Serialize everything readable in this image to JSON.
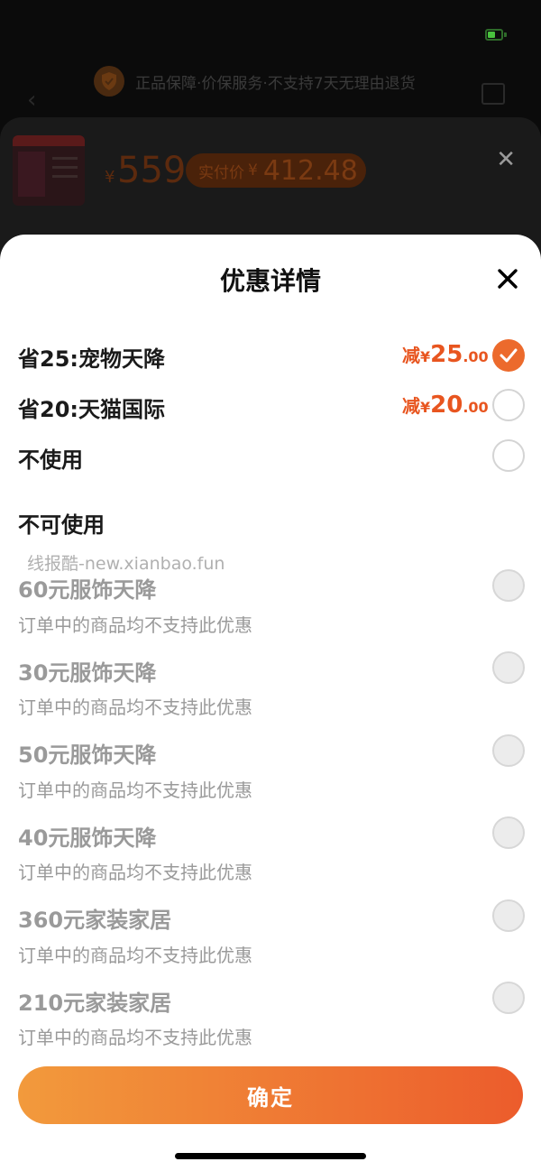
{
  "background": {
    "guarantee_text": "正品保障·价保服务·不支持7天无理由退货",
    "price_currency": "¥",
    "price": "559",
    "paid_label": "实付价",
    "paid_currency": "¥",
    "paid_amount": "412.48"
  },
  "panel": {
    "title": "优惠详情",
    "options": [
      {
        "label": "省25:宠物天降",
        "prefix": "减",
        "currency": "¥",
        "int": "25",
        "dec": ".00",
        "selected": true
      },
      {
        "label": "省20:天猫国际",
        "prefix": "减",
        "currency": "¥",
        "int": "20",
        "dec": ".00",
        "selected": false
      },
      {
        "label": "不使用",
        "selected": false
      }
    ],
    "unavailable_header": "不可使用",
    "watermark": "线报酷-new.xianbao.fun",
    "unavailable": [
      {
        "name": "60元服饰天降",
        "desc": "订单中的商品均不支持此优惠"
      },
      {
        "name": "30元服饰天降",
        "desc": "订单中的商品均不支持此优惠"
      },
      {
        "name": "50元服饰天降",
        "desc": "订单中的商品均不支持此优惠"
      },
      {
        "name": "40元服饰天降",
        "desc": "订单中的商品均不支持此优惠"
      },
      {
        "name": "360元家装家居",
        "desc": "订单中的商品均不支持此优惠"
      },
      {
        "name": "210元家装家居",
        "desc": "订单中的商品均不支持此优惠"
      }
    ],
    "confirm_label": "确定"
  },
  "colors": {
    "accent": "#ec6a2c",
    "amount": "#e8551f",
    "disabled_text": "#9a9a9a"
  }
}
